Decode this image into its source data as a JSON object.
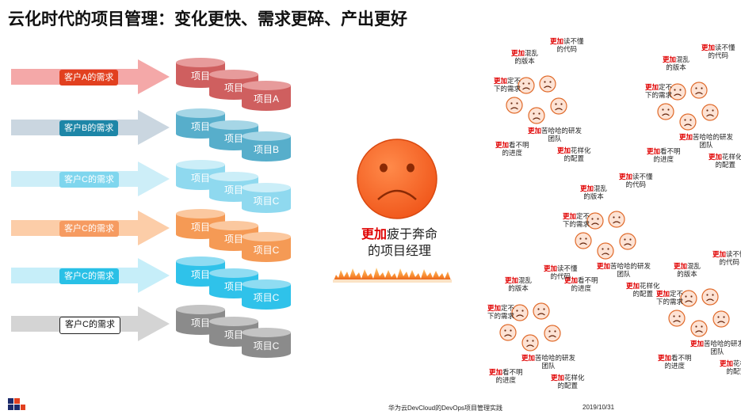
{
  "title": "云化时代的项目管理：变化更快、需求更碎、产出更好",
  "customers": [
    {
      "label": "客户A的需求",
      "arrow_color": "#f4a8a8",
      "label_bg": "#e2401f",
      "label_color": "#ffffff"
    },
    {
      "label": "客户B的需求",
      "arrow_color": "#cad6e0",
      "label_bg": "#1d86a7",
      "label_color": "#ffffff"
    },
    {
      "label": "客户C的需求",
      "arrow_color": "#cdeef8",
      "label_bg": "#7fd6ee",
      "label_color": "#ffffff"
    },
    {
      "label": "客户C的需求",
      "arrow_color": "#fccda8",
      "label_bg": "#f69b61",
      "label_color": "#ffffff"
    },
    {
      "label": "客户C的需求",
      "arrow_color": "#c6eef9",
      "label_bg": "#29c0e6",
      "label_color": "#ffffff"
    },
    {
      "label": "客户C的需求",
      "arrow_color": "#d4d4d4",
      "label_bg": "#ffffff",
      "label_color": "#111111"
    }
  ],
  "projects": [
    {
      "label_back": "项目",
      "label_mid": "项目",
      "label_front": "项目A",
      "body": "#cf5f5f",
      "top": "#e79b9b"
    },
    {
      "label_back": "项目",
      "label_mid": "项目",
      "label_front": "项目B",
      "body": "#57aecb",
      "top": "#a6d6e6"
    },
    {
      "label_back": "项目",
      "label_mid": "项目",
      "label_front": "项目C",
      "body": "#8fd9ef",
      "top": "#cbeef8"
    },
    {
      "label_back": "项目",
      "label_mid": "项目",
      "label_front": "项目C",
      "body": "#f59a55",
      "top": "#fbc89f"
    },
    {
      "label_back": "项目",
      "label_mid": "项目",
      "label_front": "项目C",
      "body": "#2fc2ea",
      "top": "#8fdcf2"
    },
    {
      "label_back": "项目",
      "label_mid": "项目",
      "label_front": "项目C",
      "body": "#8b8b8b",
      "top": "#c4c4c4"
    }
  ],
  "pm": {
    "emphasis": "更加",
    "line1_rest": "疲于奔命",
    "line2": "的项目经理"
  },
  "annotation_emphasis": "更加",
  "annotations": {
    "code": [
      "读不懂",
      "的代码"
    ],
    "version": [
      "混乱",
      "的版本"
    ],
    "req": [
      "定不",
      "下的需求"
    ],
    "team": [
      "苦哈哈的研发",
      "团队"
    ],
    "progress": [
      "看不明",
      "的进度"
    ],
    "config": [
      "花样化",
      "的配置"
    ]
  },
  "footer": {
    "center": "华为云DevCloud的DevOps项目管理实践",
    "date": "2019/10/31"
  }
}
